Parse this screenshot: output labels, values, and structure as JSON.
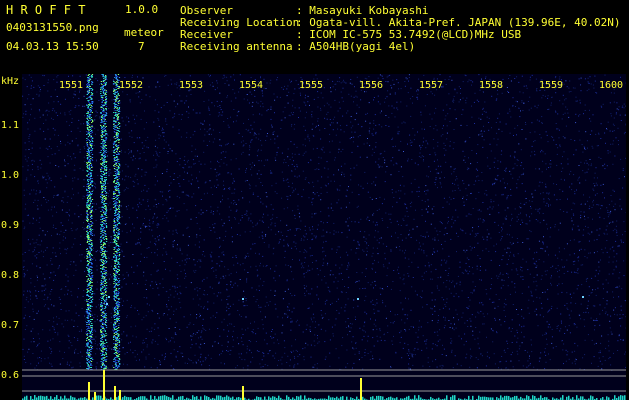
{
  "app": {
    "logo": "H R O F F T",
    "version": "1.0.0"
  },
  "file": {
    "name": "0403131550.png",
    "datetime": "04.03.13 15:50"
  },
  "meteor": {
    "label": "meteor",
    "count": "7"
  },
  "info": {
    "observer_label": "Observer",
    "observer_value": ": Masayuki Kobayashi",
    "location_label": "Receiving Location",
    "location_value": ": Ogata-vill. Akita-Pref. JAPAN (139.96E, 40.02N)",
    "receiver_label": "Receiver",
    "receiver_value": ": ICOM IC-575 53.7492(@LCD)MHz USB",
    "antenna_label": "Receiving antenna",
    "antenna_value": ": A504HB(yagi 4el)"
  },
  "axis": {
    "unit": "kHz",
    "y_ticks": [
      "1.1",
      "1.0",
      "0.9",
      "0.8",
      "0.7",
      "0.6"
    ],
    "x_ticks": [
      "1551",
      "1552",
      "1553",
      "1554",
      "1555",
      "1556",
      "1557",
      "1558",
      "1559",
      "1600"
    ]
  },
  "colors": {
    "text": "#ffff33",
    "bg": "#000000",
    "noise": "#1a2a9a"
  }
}
